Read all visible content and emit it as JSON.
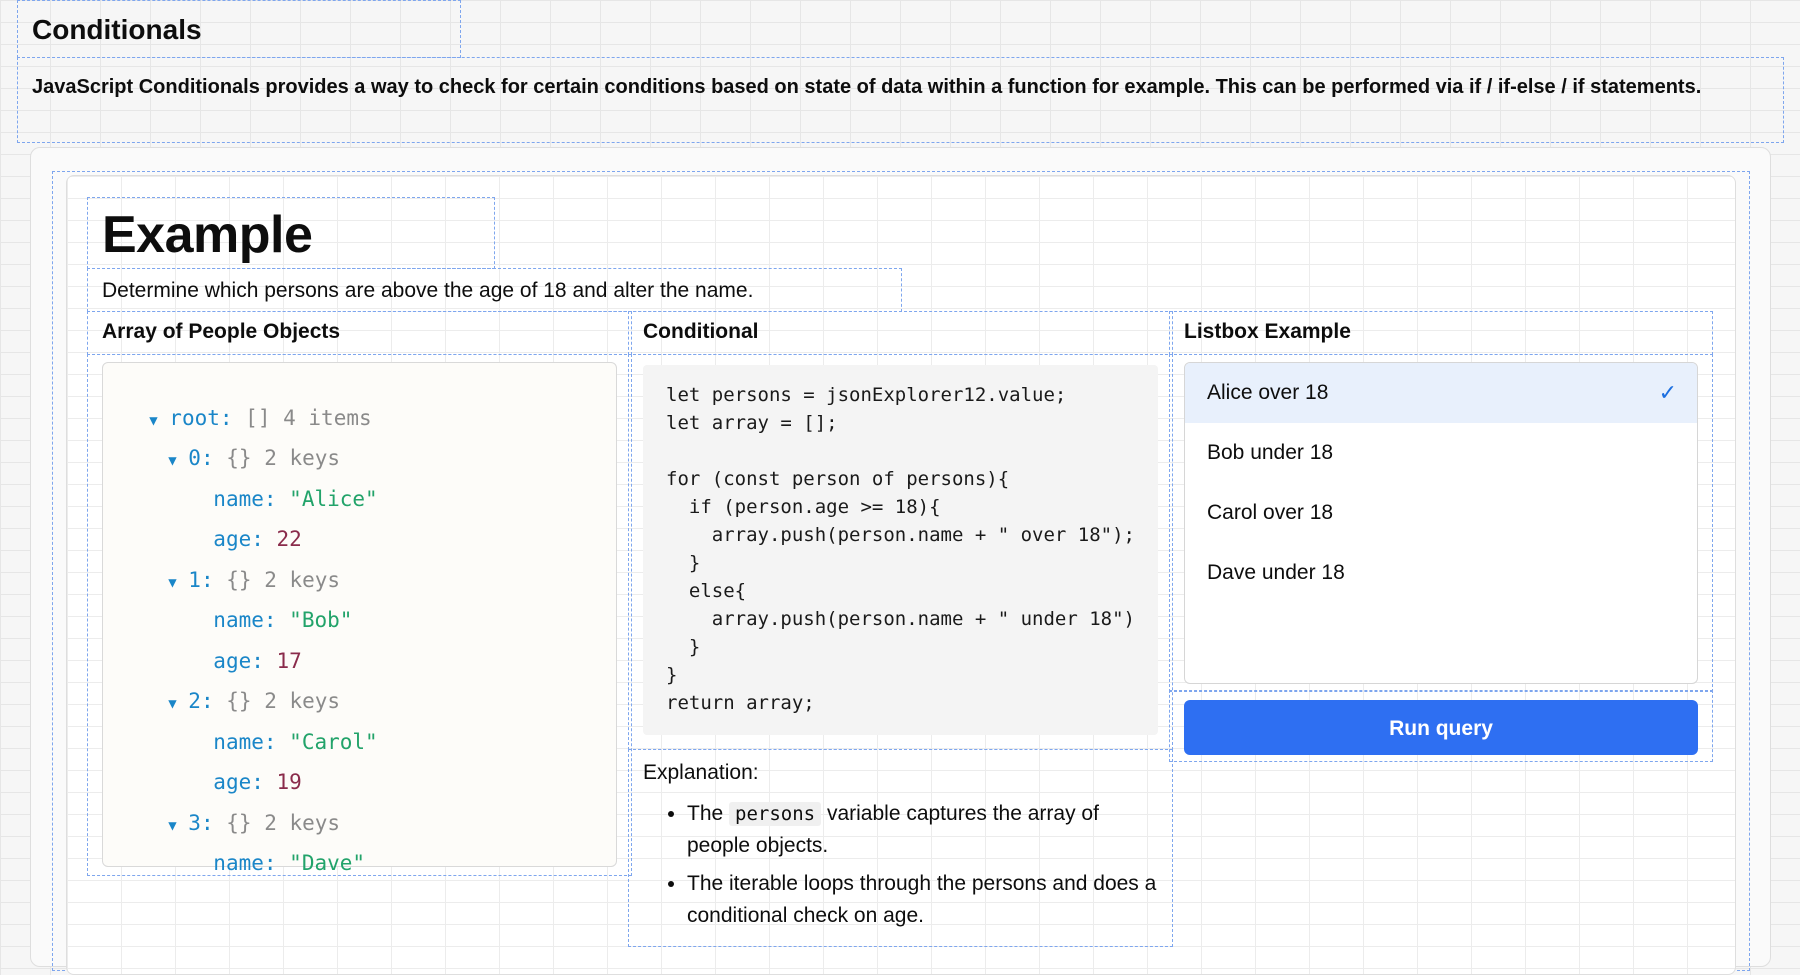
{
  "header": {
    "title": "Conditionals",
    "description": "JavaScript Conditionals provides a way to check for certain conditions based on state of data within a function for example. This can be performed via if / if-else / if statements."
  },
  "example": {
    "title": "Example",
    "description": "Determine which persons are above the age of 18 and alter the name."
  },
  "columns": {
    "array": {
      "label": "Array of People Objects"
    },
    "conditional": {
      "label": "Conditional"
    },
    "listbox": {
      "label": "Listbox Example"
    }
  },
  "json_explorer": {
    "root": {
      "key": "root:",
      "type": "[]",
      "count": "4 items"
    },
    "items": [
      {
        "key": "0:",
        "type": "{}",
        "count": "2 keys",
        "name_key": "name:",
        "name": "\"Alice\"",
        "age_key": "age:",
        "age": "22"
      },
      {
        "key": "1:",
        "type": "{}",
        "count": "2 keys",
        "name_key": "name:",
        "name": "\"Bob\"",
        "age_key": "age:",
        "age": "17"
      },
      {
        "key": "2:",
        "type": "{}",
        "count": "2 keys",
        "name_key": "name:",
        "name": "\"Carol\"",
        "age_key": "age:",
        "age": "19"
      },
      {
        "key": "3:",
        "type": "{}",
        "count": "2 keys",
        "name_key": "name:",
        "name": "\"Dave\""
      }
    ]
  },
  "code": {
    "text": "let persons = jsonExplorer12.value;\nlet array = [];\n\nfor (const person of persons){\n  if (person.age >= 18){\n    array.push(person.name + \" over 18\");\n  }\n  else{\n    array.push(person.name + \" under 18\")\n  }\n}\nreturn array;"
  },
  "explanation": {
    "heading": "Explanation:",
    "bullet1_prefix": "The",
    "bullet1_code": "persons",
    "bullet1_suffix": "variable captures the array of people objects.",
    "bullet2": "The iterable loops through the persons and does a conditional check on age."
  },
  "listbox": {
    "items": [
      "Alice over 18",
      "Bob under 18",
      "Carol over 18",
      "Dave under 18"
    ],
    "selected": "Alice over 18"
  },
  "run_button": {
    "label": "Run query"
  },
  "colors": {
    "accent": "#2e6ff2",
    "selected_bg": "#e8f0fc",
    "dashed_outline": "#7ea6ee",
    "json_key": "#1a86c8",
    "json_string": "#22a36a",
    "json_number": "#8a2b4b"
  },
  "icons": {
    "caret": "caret-down-icon",
    "check": "check-icon"
  }
}
